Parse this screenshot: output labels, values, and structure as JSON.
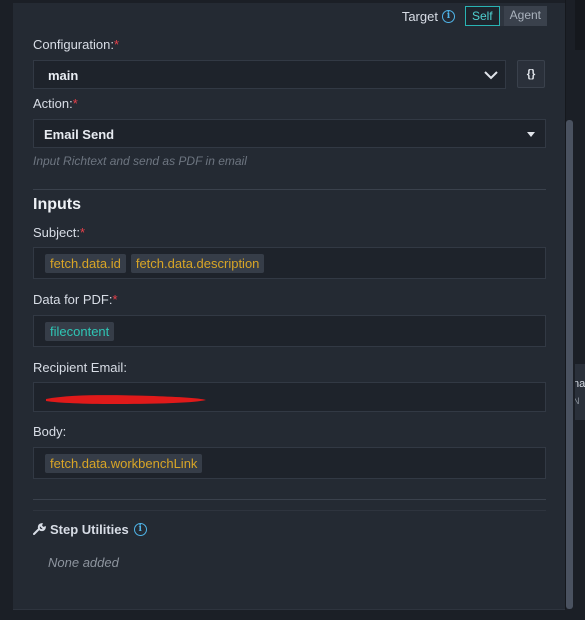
{
  "target": {
    "label": "Target",
    "options": [
      "Self",
      "Agent"
    ],
    "selected": "Self"
  },
  "configuration": {
    "label": "Configuration:",
    "required": "*",
    "value": "main",
    "json_button": "{}"
  },
  "action": {
    "label": "Action:",
    "required": "*",
    "value": "Email Send",
    "hint": "Input Richtext and send as PDF in email"
  },
  "inputs": {
    "title": "Inputs",
    "subject": {
      "label": "Subject:",
      "required": "*",
      "tokens": [
        "fetch.data.id",
        "fetch.data.description"
      ]
    },
    "data_for_pdf": {
      "label": "Data for PDF:",
      "required": "*",
      "tokens": [
        "filecontent"
      ]
    },
    "recipient_email": {
      "label": "Recipient Email:"
    },
    "body": {
      "label": "Body:",
      "tokens": [
        "fetch.data.workbenchLink"
      ]
    }
  },
  "step_utilities": {
    "label": "Step Utilities",
    "empty_text": "None added"
  },
  "side_peek": {
    "line1": "na",
    "line2": "N"
  },
  "colors": {
    "accent_teal": "#29b3b3",
    "token_gold": "#d8a526",
    "token_teal": "#2fc5b5",
    "required_red": "#e8404a",
    "info_blue": "#4fb4e8"
  }
}
